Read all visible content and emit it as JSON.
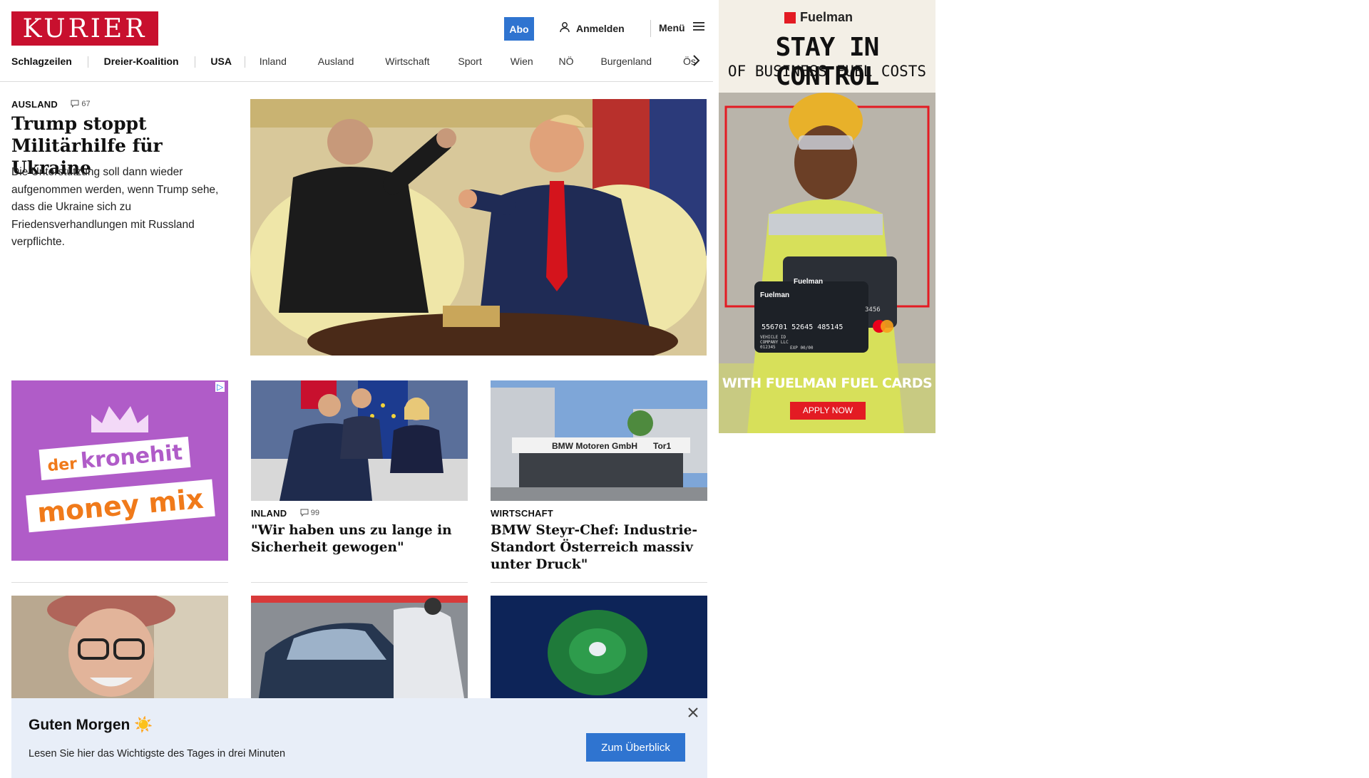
{
  "header": {
    "logo_text": "KURIER",
    "abo_label": "Abo",
    "login_label": "Anmelden",
    "menu_label": "Menü",
    "nav": [
      "Schlagzeilen",
      "Dreier-Koalition",
      "USA",
      "Inland",
      "Ausland",
      "Wirtschaft",
      "Sport",
      "Wien",
      "NÖ",
      "Burgenland",
      "Österreich"
    ]
  },
  "lead": {
    "section": "AUSLAND",
    "comments": "67",
    "title": "Trump stoppt Militärhilfe für Ukraine",
    "teaser": "Die Unterstützung soll dann wieder aufgenommen werden, wenn Trump sehe, dass die Ukraine sich zu Friedensverhandlungen mit Russland verpflichte."
  },
  "ad_kronehit": {
    "line1": "der",
    "line2": "kronehit",
    "line3": "money mix"
  },
  "cards": [
    {
      "section": "INLAND",
      "comments": "99",
      "title": "\"Wir haben uns zu lange in Sicherheit gewogen\""
    },
    {
      "section": "WIRTSCHAFT",
      "title": "BMW Steyr-Chef: Industrie-Standort Österreich massiv unter Druck\""
    }
  ],
  "card2_image_sign": {
    "left": "BMW Motoren GmbH",
    "right": "Tor1"
  },
  "banner": {
    "title": "Guten Morgen ☀️",
    "text": "Lesen Sie hier das Wichtigste des Tages in drei Minuten",
    "button": "Zum Überblick"
  },
  "ad_fuelman": {
    "brand": "Fuelman",
    "headline": "STAY IN CONTROL",
    "subline": "OF BUSINESS FUEL COSTS",
    "card_number": "556701 52645 485145",
    "card_number_right": "3456",
    "card_line1": "VEHICLE ID",
    "card_line2": "COMPANY LLC",
    "card_line3": "012345",
    "card_exp": "EXP 00/00",
    "tagline": "WITH FUELMAN FUEL CARDS",
    "cta": "APPLY NOW"
  },
  "colors": {
    "logo_red": "#c8102e",
    "accent_blue": "#2f74d0",
    "fuelman_red": "#e31b23",
    "banner_bg": "#e8eef8",
    "kronehit_purple": "#b05cc8"
  }
}
